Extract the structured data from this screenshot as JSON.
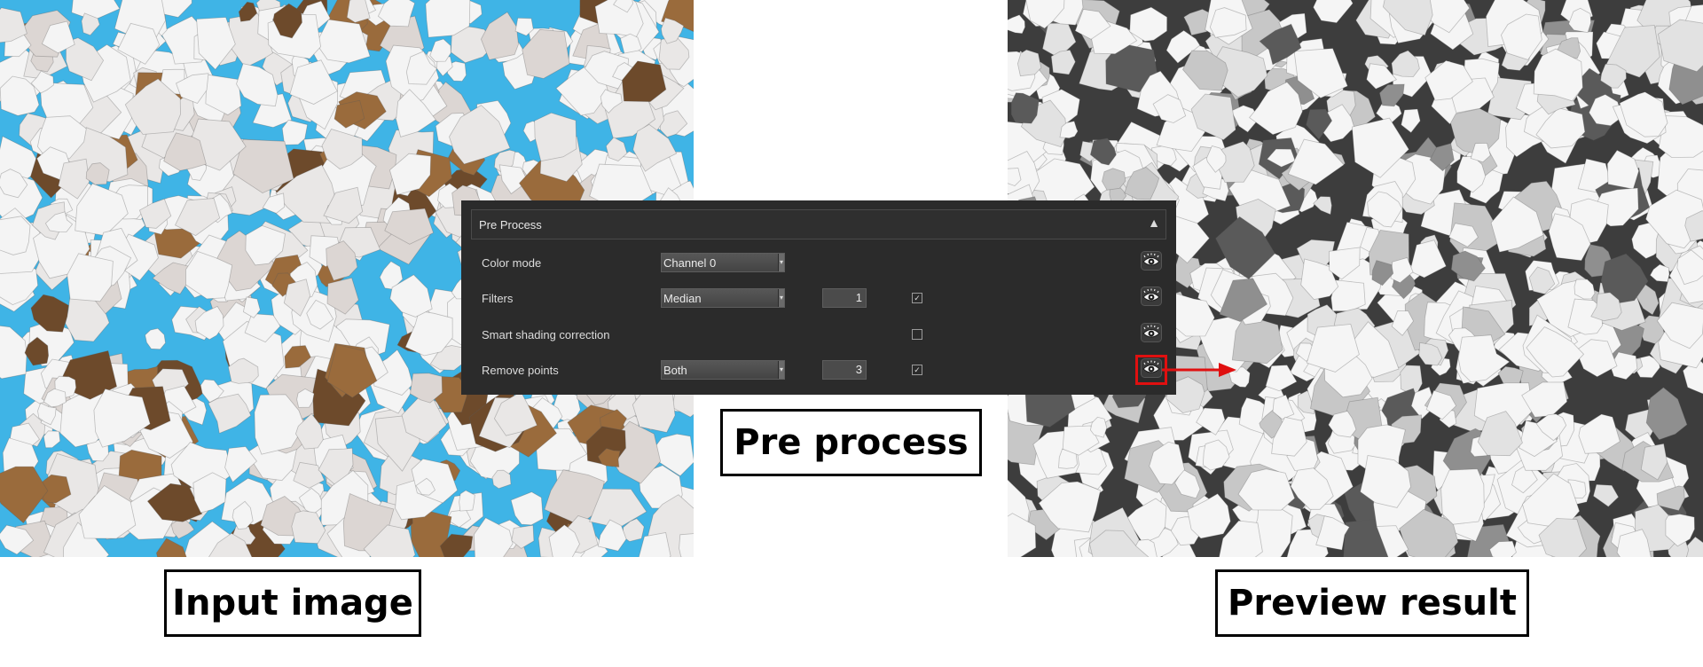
{
  "captions": {
    "input": "Input image",
    "pre_process": "Pre process",
    "preview": "Preview result"
  },
  "panel": {
    "title": "Pre Process",
    "collapse_icon": "triangle-up-icon",
    "rows": [
      {
        "label": "Color mode",
        "dropdown": "Channel 0"
      },
      {
        "label": "Filters",
        "dropdown": "Median",
        "number": "1",
        "checked": true
      },
      {
        "label": "Smart shading correction",
        "checked": false
      },
      {
        "label": "Remove points",
        "dropdown": "Both",
        "number": "3",
        "checked": true
      }
    ],
    "eye_icon": "eye-icon"
  },
  "colors": {
    "panel_bg": "#2b2b2b",
    "pore_blue": "#3fb4e6",
    "highlight_red": "#e01010"
  }
}
